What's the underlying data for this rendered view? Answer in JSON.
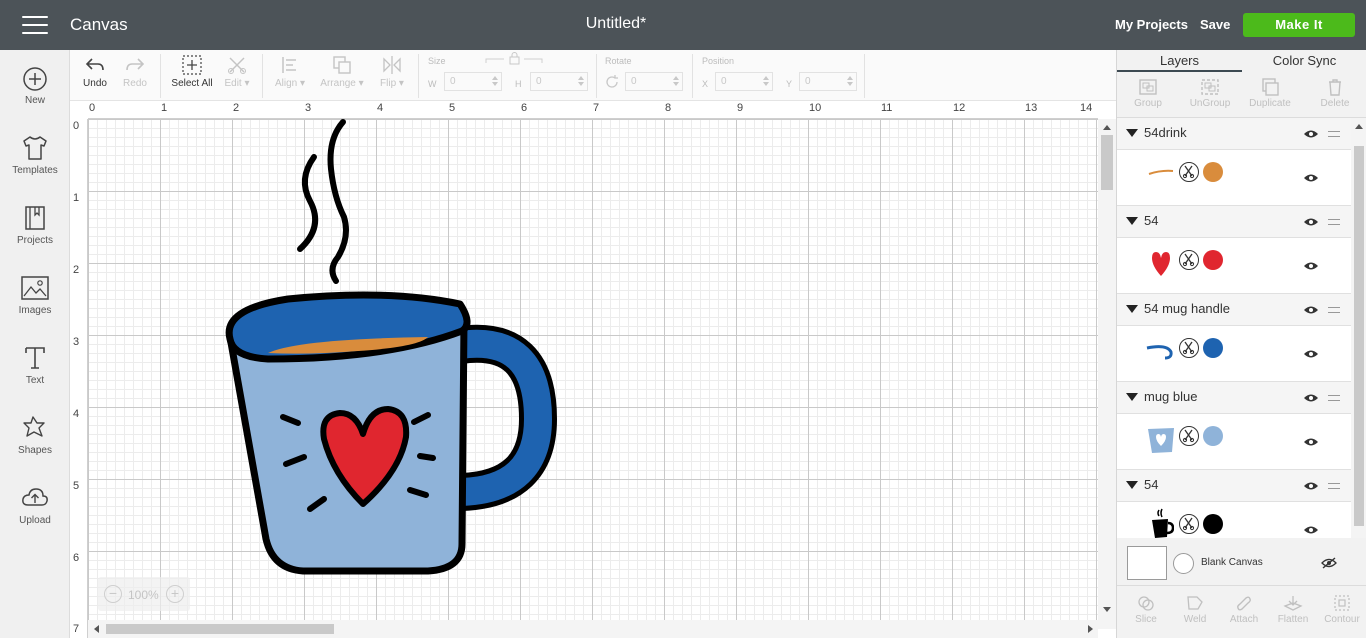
{
  "header": {
    "app_title": "Canvas",
    "doc_title": "Untitled*",
    "my_projects": "My Projects",
    "save": "Save",
    "make_it": "Make It"
  },
  "sidebar": {
    "items": [
      {
        "label": "New",
        "icon": "plus-circle-icon"
      },
      {
        "label": "Templates",
        "icon": "shirt-icon"
      },
      {
        "label": "Projects",
        "icon": "notebook-icon"
      },
      {
        "label": "Images",
        "icon": "image-icon"
      },
      {
        "label": "Text",
        "icon": "text-t-icon"
      },
      {
        "label": "Shapes",
        "icon": "shapes-icon"
      },
      {
        "label": "Upload",
        "icon": "cloud-upload-icon"
      }
    ]
  },
  "toolbar": {
    "undo": "Undo",
    "redo": "Redo",
    "select_all": "Select All",
    "edit": "Edit",
    "align": "Align",
    "arrange": "Arrange",
    "flip": "Flip",
    "size_label": "Size",
    "w_label": "W",
    "w_value": "0",
    "h_label": "H",
    "h_value": "0",
    "rotate_label": "Rotate",
    "rotate_value": "0",
    "position_label": "Position",
    "x_label": "X",
    "x_value": "0",
    "y_label": "Y",
    "y_value": "0"
  },
  "rulers": {
    "top": [
      "0",
      "1",
      "2",
      "3",
      "4",
      "5",
      "6",
      "7",
      "8",
      "9",
      "10",
      "11",
      "12",
      "13",
      "14"
    ],
    "left": [
      "0",
      "1",
      "2",
      "3",
      "4",
      "5",
      "6",
      "7"
    ]
  },
  "zoom": {
    "value": "100%",
    "minus": "−",
    "plus": "+"
  },
  "right_panel": {
    "tabs": [
      "Layers",
      "Color Sync"
    ],
    "actions": [
      "Group",
      "UnGroup",
      "Duplicate",
      "Delete"
    ],
    "layers": [
      {
        "name": "54drink",
        "color": "#d98c3c"
      },
      {
        "name": "54",
        "color": "#e0262f"
      },
      {
        "name": "54 mug handle",
        "color": "#1e63b0"
      },
      {
        "name": "mug blue",
        "color": "#8fb3d9"
      },
      {
        "name": "54",
        "color": "#000000"
      }
    ],
    "blank_canvas": "Blank Canvas",
    "bottom_actions": [
      "Slice",
      "Weld",
      "Attach",
      "Flatten",
      "Contour"
    ]
  },
  "colors": {
    "header_bg": "#4c5358",
    "make_it": "#4cba1b",
    "mug_body": "#8fb3d9",
    "mug_rim": "#1e63b0",
    "drink": "#d98c3c",
    "heart": "#e0262f"
  }
}
